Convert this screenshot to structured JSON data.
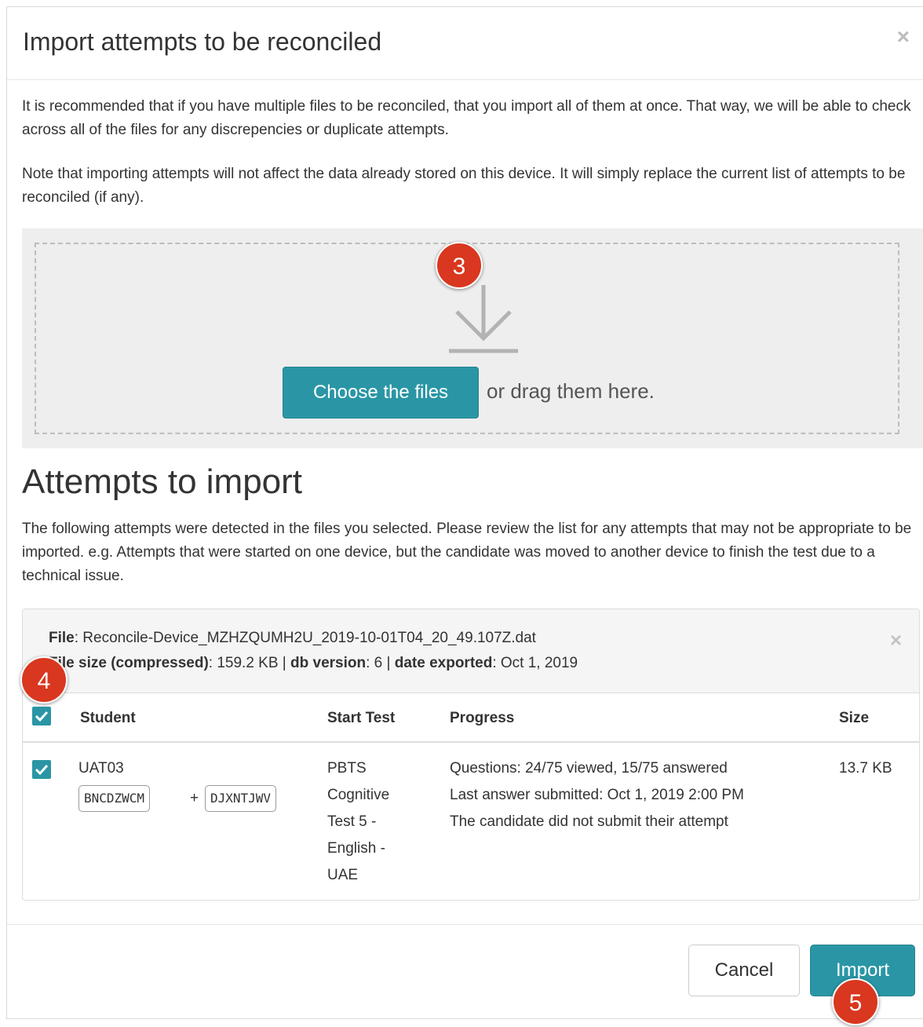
{
  "modal": {
    "title": "Import attempts to be reconciled",
    "close_symbol": "×"
  },
  "intro": {
    "paragraph1": "It is recommended that if you have multiple files to be reconciled, that you import all of them at once. That way, we will be able to check across all of the files for any discrepencies or duplicate attempts.",
    "paragraph2": "Note that importing attempts will not affect the data already stored on this device. It will simply replace the current list of attempts to be reconciled (if any)."
  },
  "dropzone": {
    "icon": "download-arrow-icon",
    "choose_button": "Choose the files",
    "drag_text": "or drag them here."
  },
  "attempts_section": {
    "heading": "Attempts to import",
    "description": "The following attempts were detected in the files you selected. Please review the list for any attempts that may not be appropriate to be imported. e.g. Attempts that were started on one device, but the candidate was moved to another device to finish the test due to a technical issue."
  },
  "file": {
    "file_label": "File",
    "file_name": ": Reconcile-Device_MZHZQUMH2U_2019-10-01T04_20_49.107Z.dat",
    "size_label": "File size (compressed)",
    "size_value": ": 159.2 KB | ",
    "db_label": "db version",
    "db_value": ": 6 | ",
    "date_label": "date exported",
    "date_value": ": Oct 1, 2019",
    "close_symbol": "×"
  },
  "table": {
    "headers": {
      "student": "Student",
      "start_test": "Start Test",
      "progress": "Progress",
      "size": "Size"
    },
    "header_checked": true,
    "rows": [
      {
        "checked": true,
        "student": "UAT03",
        "code1": "BNCDZWCM",
        "plus": "+",
        "code2": "DJXNTJWV",
        "test_lines": [
          "PBTS",
          "Cognitive",
          "Test 5 -",
          "English -",
          "UAE"
        ],
        "progress_lines": [
          "Questions: 24/75 viewed, 15/75 answered",
          "Last answer submitted: Oct 1, 2019 2:00 PM",
          "The candidate did not submit their attempt"
        ],
        "size": "13.7 KB"
      }
    ]
  },
  "footer": {
    "cancel": "Cancel",
    "import": "Import"
  },
  "annotations": {
    "badge3": "3",
    "badge4": "4",
    "badge5": "5",
    "badge_color": "#d9371f"
  },
  "colors": {
    "accent": "#2a96a5"
  }
}
